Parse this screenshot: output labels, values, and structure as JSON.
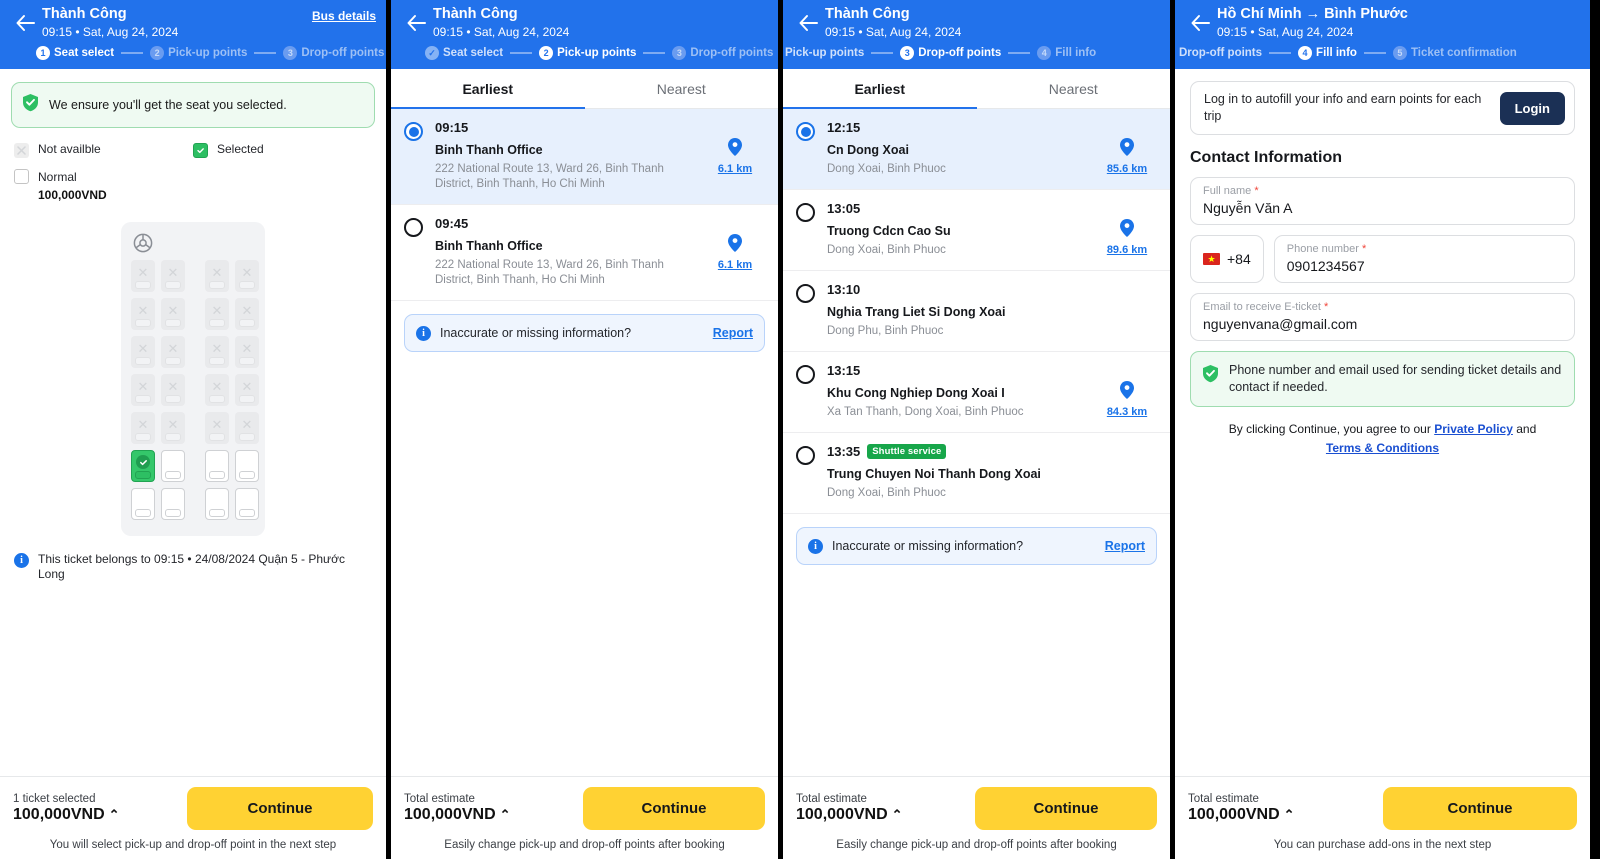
{
  "panel1": {
    "header": {
      "title": "Thành Công",
      "subtitle": "09:15 • Sat, Aug 24, 2024",
      "bus_details": "Bus details"
    },
    "steps": [
      {
        "num": "1",
        "label": "Seat select",
        "state": "active"
      },
      {
        "num": "2",
        "label": "Pick-up points",
        "state": "todo"
      },
      {
        "num": "3",
        "label": "Drop-off points",
        "state": "todo"
      }
    ],
    "ensure_text": "We ensure you'll get the seat you selected.",
    "legend": [
      {
        "label": "Not availble",
        "kind": "na",
        "price": ""
      },
      {
        "label": "Selected",
        "kind": "sel",
        "price": ""
      },
      {
        "label": "Normal",
        "kind": "normal",
        "price": "100,000VND"
      }
    ],
    "seat_rows": [
      [
        "na",
        "na",
        "na",
        "na"
      ],
      [
        "na",
        "na",
        "na",
        "na"
      ],
      [
        "na",
        "na",
        "na",
        "na"
      ],
      [
        "na",
        "na",
        "na",
        "na"
      ],
      [
        "na",
        "na",
        "na",
        "na"
      ],
      [
        "picked",
        "free",
        "free",
        "free"
      ],
      [
        "free",
        "free",
        "free",
        "free"
      ]
    ],
    "note": "This ticket belongs to 09:15 • 24/08/2024 Quận 5 - Phước Long",
    "footer": {
      "small": "1 ticket selected",
      "price": "100,000VND",
      "caret": "⌃",
      "continue": "Continue",
      "hint": "You will select pick-up and drop-off point in the next step"
    }
  },
  "panel2": {
    "header": {
      "title": "Thành Công",
      "subtitle": "09:15 • Sat, Aug 24, 2024"
    },
    "steps": [
      {
        "num": "✓",
        "label": "Seat select",
        "state": "done"
      },
      {
        "num": "2",
        "label": "Pick-up points",
        "state": "active"
      },
      {
        "num": "3",
        "label": "Drop-off points",
        "state": "todo"
      }
    ],
    "tabs": [
      {
        "label": "Earliest",
        "active": true
      },
      {
        "label": "Nearest",
        "active": false
      }
    ],
    "points": [
      {
        "time": "09:15",
        "name": "Binh Thanh Office",
        "address": "222 National Route 13, Ward 26, Binh Thanh District, Binh Thanh, Ho Chi Minh",
        "distance": "6.1 km",
        "selected": true,
        "badge": ""
      },
      {
        "time": "09:45",
        "name": "Binh Thanh Office",
        "address": "222 National Route 13, Ward 26, Binh Thanh District, Binh Thanh, Ho Chi Minh",
        "distance": "6.1 km",
        "selected": false,
        "badge": ""
      }
    ],
    "report": {
      "text": "Inaccurate or missing information?",
      "link": "Report"
    },
    "footer": {
      "small": "Total estimate",
      "price": "100,000VND",
      "caret": "⌃",
      "continue": "Continue",
      "hint": "Easily change pick-up and drop-off points after booking"
    }
  },
  "panel3": {
    "header": {
      "title": "Thành Công",
      "subtitle": "09:15 • Sat, Aug 24, 2024"
    },
    "steps": [
      {
        "num": "✓",
        "label": "Pick-up points",
        "state": "done"
      },
      {
        "num": "3",
        "label": "Drop-off points",
        "state": "active"
      },
      {
        "num": "4",
        "label": "Fill info",
        "state": "todo"
      }
    ],
    "tabs": [
      {
        "label": "Earliest",
        "active": true
      },
      {
        "label": "Nearest",
        "active": false
      }
    ],
    "points": [
      {
        "time": "12:15",
        "name": "Cn Dong Xoai",
        "address": "Dong Xoai, Binh Phuoc",
        "distance": "85.6 km",
        "selected": true,
        "badge": ""
      },
      {
        "time": "13:05",
        "name": "Truong Cdcn Cao Su",
        "address": "Dong Xoai, Binh Phuoc",
        "distance": "89.6 km",
        "selected": false,
        "badge": ""
      },
      {
        "time": "13:10",
        "name": "Nghia Trang Liet Si Dong Xoai",
        "address": "Dong Phu, Binh Phuoc",
        "distance": "",
        "selected": false,
        "badge": ""
      },
      {
        "time": "13:15",
        "name": "Khu Cong Nghiep Dong Xoai I",
        "address": "Xa Tan Thanh, Dong Xoai, Binh Phuoc",
        "distance": "84.3 km",
        "selected": false,
        "badge": ""
      },
      {
        "time": "13:35",
        "name": "Trung Chuyen Noi Thanh Dong Xoai",
        "address": "Dong Xoai, Binh Phuoc",
        "distance": "",
        "selected": false,
        "badge": "Shuttle service"
      }
    ],
    "report": {
      "text": "Inaccurate or missing information?",
      "link": "Report"
    },
    "footer": {
      "small": "Total estimate",
      "price": "100,000VND",
      "caret": "⌃",
      "continue": "Continue",
      "hint": "Easily change pick-up and drop-off points after booking"
    }
  },
  "panel4": {
    "header": {
      "title": "Hồ Chí Minh → Bình Phước",
      "subtitle": "09:15 • Sat, Aug 24, 2024"
    },
    "steps": [
      {
        "num": "✓",
        "label": "Drop-off points",
        "state": "done"
      },
      {
        "num": "4",
        "label": "Fill info",
        "state": "active"
      },
      {
        "num": "5",
        "label": "Ticket confirmation",
        "state": "todo"
      }
    ],
    "login_text": "Log in to autofill your info and earn points for each trip",
    "login_button": "Login",
    "section_title": "Contact Information",
    "fields": {
      "full_name_label": "Full name",
      "full_name_value": "Nguyễn Văn A",
      "country_code": "+84",
      "phone_label": "Phone number",
      "phone_value": "0901234567",
      "email_label": "Email to receive E-ticket",
      "email_value": "nguyenvana@gmail.com"
    },
    "green_note": "Phone number and email used for sending ticket details and contact if needed.",
    "terms": {
      "prefix": "By clicking Continue, you agree to our ",
      "link1": "Private Policy",
      "middle": " and",
      "link2": "Terms & Conditions"
    },
    "footer": {
      "small": "Total estimate",
      "price": "100,000VND",
      "caret": "⌃",
      "continue": "Continue",
      "hint": "You can purchase add-ons in the next step"
    }
  }
}
